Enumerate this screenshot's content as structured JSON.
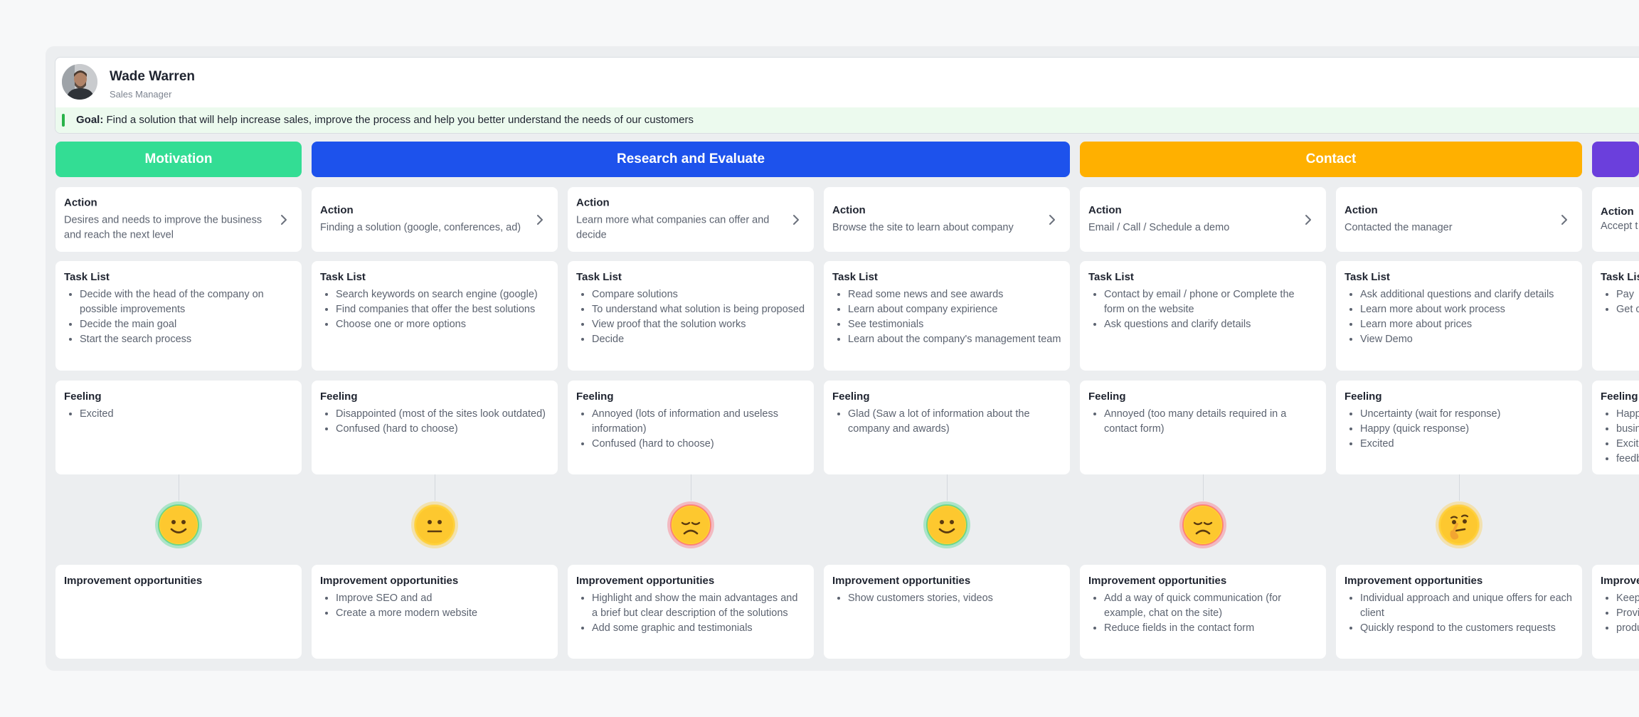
{
  "persona": {
    "name": "Wade Warren",
    "role": "Sales Manager",
    "goal_label": "Goal:",
    "goal_text": "Find a solution that will help increase sales, improve the process and help you better understand the needs of our customers"
  },
  "colors": {
    "motivation": "#33dd94",
    "research": "#1d52ec",
    "contact": "#ffb000",
    "next_stage": "#6b3fdc",
    "goal_accent": "#29b34a"
  },
  "stages": [
    {
      "label": "Motivation"
    },
    {
      "label": "Research and Evaluate"
    },
    {
      "label": "Contact"
    },
    {
      "label": ""
    }
  ],
  "labels": {
    "action": "Action",
    "tasks": "Task List",
    "feeling": "Feeling",
    "improve": "Improvement opportunities"
  },
  "columns": [
    {
      "action": "Desires and needs to improve the business and reach the next level",
      "tasks": [
        "Decide with the head of the company on possible improvements",
        "Decide the main goal",
        "Start the search process"
      ],
      "feelings": [
        "Excited"
      ],
      "emotion": "happy",
      "improvements": []
    },
    {
      "action": "Finding a solution (google, conferences, ad)",
      "tasks": [
        "Search keywords on search engine (google)",
        "Find companies that offer the best solutions",
        "Choose one or more options"
      ],
      "feelings": [
        "Disappointed (most of the sites look outdated)",
        "Confused (hard to choose)"
      ],
      "emotion": "neutral",
      "improvements": [
        "Improve SEO and ad",
        "Create a more modern website"
      ]
    },
    {
      "action": "Learn more what companies can offer and decide",
      "tasks": [
        "Compare solutions",
        "To understand what solution is being proposed",
        "View proof that the solution works",
        "Decide"
      ],
      "feelings": [
        "Annoyed (lots of information and useless information)",
        "Confused (hard to choose)"
      ],
      "emotion": "sad",
      "improvements": [
        "Highlight and show the main advantages and a brief but clear description of the solutions",
        "Add some graphic and testimonials"
      ]
    },
    {
      "action": "Browse the site to learn about company",
      "tasks": [
        "Read some news and see awards",
        "Learn about company expirience",
        "See testimonials",
        "Learn about the company's management team"
      ],
      "feelings": [
        "Glad (Saw a lot of information about the company and awards)"
      ],
      "emotion": "happy",
      "improvements": [
        "Show customers stories, videos"
      ]
    },
    {
      "action": "Email / Call / Schedule a demo",
      "tasks": [
        "Contact by email / phone or Complete the form on the website",
        "Ask questions and clarify details"
      ],
      "feelings": [
        "Annoyed (too many details required in a contact form)"
      ],
      "emotion": "sad",
      "improvements": [
        "Add a way of quick communication (for example, chat on the site)",
        "Reduce fields in the contact form"
      ]
    },
    {
      "action": "Contacted the manager",
      "tasks": [
        "Ask additional questions and clarify details",
        "Learn more about work process",
        "Learn more about prices",
        "View Demo"
      ],
      "feelings": [
        "Uncertainty (wait for response)",
        "Happy (quick response)",
        "Excited"
      ],
      "emotion": "thinking",
      "improvements": [
        "Individual approach and unique offers for each client",
        "Quickly respond to the customers requests"
      ]
    },
    {
      "action": "Accept t",
      "tasks": [
        "Pay",
        "Get c"
      ],
      "feelings": [
        "Happ",
        "busin",
        "Excit",
        "feedb"
      ],
      "emotion": "",
      "improvements": [
        "Keep",
        "Provi",
        "produ"
      ]
    }
  ],
  "partial_labels": {
    "tasks": "Task Lis",
    "feeling": "Feeling",
    "improve": "Improve"
  }
}
